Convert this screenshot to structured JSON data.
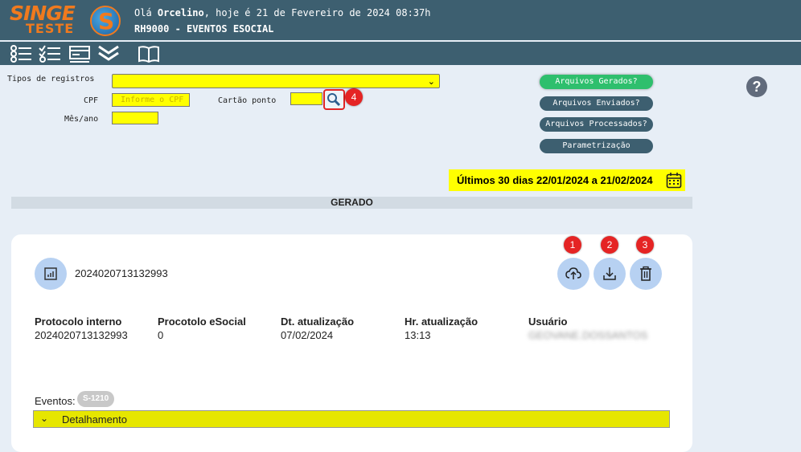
{
  "header": {
    "logo_top": "SINGE",
    "logo_bottom": "TESTE",
    "logo_mark": "S",
    "greeting_prefix": "Olá",
    "user_name": "Orcelino",
    "greeting_suffix": ", hoje é 21 de Fevereiro de 2024 08:37h",
    "module_title": "RH9000 - EVENTOS ESOCIAL"
  },
  "toolbar": {
    "icons": [
      "list-icon",
      "checklist-icon",
      "card-icon",
      "double-chevron-down-icon",
      "book-icon"
    ]
  },
  "filters": {
    "tipos_label": "Tipos de registros",
    "cpf_label": "CPF",
    "cpf_placeholder": "Informe o CPF",
    "cartao_label": "Cartão ponto",
    "mes_label": "Mês/ano",
    "search_badge": "4"
  },
  "side_buttons": {
    "gerados": "Arquivos Gerados?",
    "enviados": "Arquivos Enviados?",
    "processados": "Arquivos Processados?",
    "parametrizacao": "Parametrização"
  },
  "help_label": "?",
  "date_range": "Últimos 30 dias 22/01/2024 a 21/02/2024",
  "section_title": "GERADO",
  "card": {
    "id": "2024020713132993",
    "badges": [
      "1",
      "2",
      "3"
    ],
    "columns": [
      {
        "header": "Protocolo interno",
        "value": "2024020713132993"
      },
      {
        "header": "Procotolo eSocial",
        "value": "0"
      },
      {
        "header": "Dt. atualização",
        "value": "07/02/2024"
      },
      {
        "header": "Hr. atualização",
        "value": "13:13"
      },
      {
        "header": "Usuário",
        "value": "GEOVANE.DOSSANTOS"
      }
    ],
    "eventos_label": "Eventos:",
    "event_chip": "S-1210",
    "detail_label": "Detalhamento"
  },
  "colors": {
    "header_bg": "#3d5f70",
    "brand_orange": "#f07a1e",
    "highlight_yellow": "#ffff00",
    "active_green": "#2ebf6d",
    "badge_red": "#e52424",
    "action_circle": "#b7d1f2"
  }
}
